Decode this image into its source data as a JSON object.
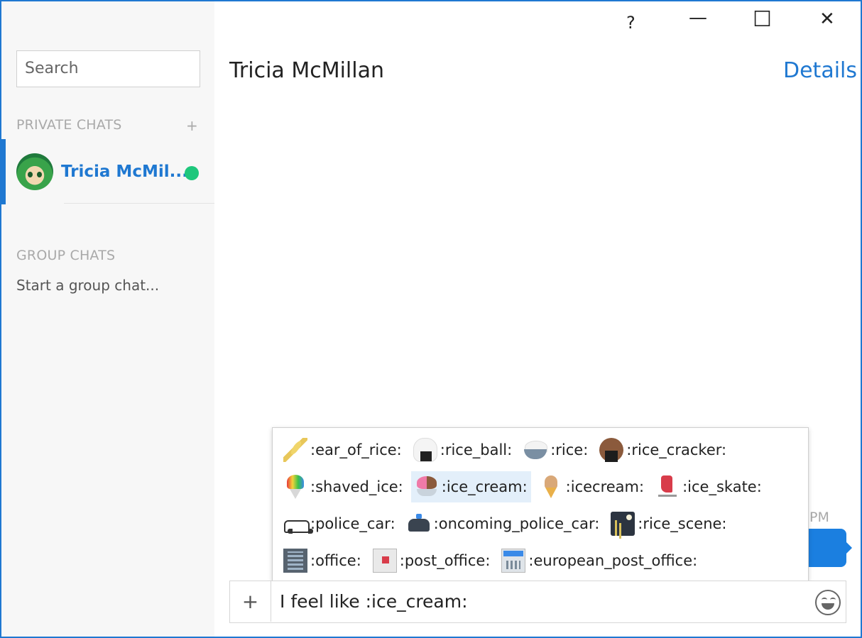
{
  "window": {
    "controls": {
      "help": "?",
      "minimize": "—",
      "maximize": "☐",
      "close": "✕"
    }
  },
  "sidebar": {
    "search_placeholder": "Search",
    "private_chats_title": "PRIVATE CHATS",
    "add_label": "+",
    "chats": [
      {
        "name": "Tricia McMil...",
        "status": "online",
        "status_color": "#1ec77c"
      }
    ],
    "group_chats_title": "GROUP CHATS",
    "group_hint": "Start a group chat..."
  },
  "main": {
    "chat_title": "Tricia McMillan",
    "details_label": "Details",
    "time_fragment": "PM",
    "accent_color": "#1f78d1"
  },
  "emoji_popup": {
    "rows": [
      [
        {
          "icon": "ear-of-rice-icon",
          "label": ":ear_of_rice:"
        },
        {
          "icon": "rice-ball-icon",
          "label": ":rice_ball:"
        },
        {
          "icon": "rice-icon",
          "label": ":rice:"
        },
        {
          "icon": "rice-cracker-icon",
          "label": ":rice_cracker:"
        }
      ],
      [
        {
          "icon": "shaved-ice-icon",
          "label": ":shaved_ice:"
        },
        {
          "icon": "ice-cream-icon",
          "label": ":ice_cream:",
          "selected": true
        },
        {
          "icon": "icecream-icon",
          "label": ":icecream:"
        },
        {
          "icon": "ice-skate-icon",
          "label": ":ice_skate:"
        }
      ],
      [
        {
          "icon": "police-car-icon",
          "label": ":police_car:"
        },
        {
          "icon": "oncoming-police-car-icon",
          "label": ":oncoming_police_car:"
        },
        {
          "icon": "rice-scene-icon",
          "label": ":rice_scene:"
        }
      ],
      [
        {
          "icon": "office-icon",
          "label": ":office:"
        },
        {
          "icon": "post-office-icon",
          "label": ":post_office:"
        },
        {
          "icon": "european-post-office-icon",
          "label": ":european_post_office:"
        }
      ]
    ]
  },
  "composer": {
    "attach_label": "+",
    "message_text": "I feel like :ice_cream:",
    "emoji_button_icon": "smiley-icon"
  }
}
